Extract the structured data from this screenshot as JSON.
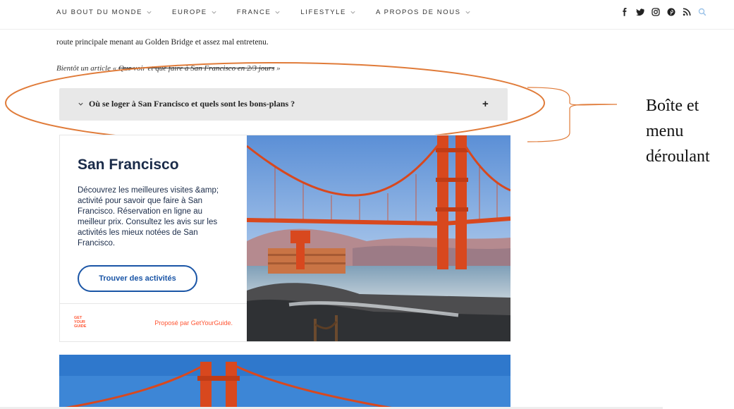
{
  "nav": {
    "items": [
      {
        "label": "AU BOUT DU MONDE"
      },
      {
        "label": "EUROPE"
      },
      {
        "label": "FRANCE"
      },
      {
        "label": "LIFESTYLE"
      },
      {
        "label": "A PROPOS DE NOUS"
      }
    ],
    "social_icons": [
      "facebook-icon",
      "twitter-icon",
      "instagram-icon",
      "pinterest-icon",
      "rss-icon",
      "search-icon"
    ],
    "search_color": "#9cc3e8"
  },
  "article": {
    "paragraph": "route principale menant au Golden Bridge et assez mal entretenu.",
    "teaser_prefix": "Bientôt un article « ",
    "teaser_link": "Que voir et que faire à San Francisco en 2/3 jours",
    "teaser_suffix": " »"
  },
  "accordion": {
    "title": "Où se loger à San Francisco et quels sont les bons-plans ?",
    "toggle": "+"
  },
  "annotation": {
    "label": "Boîte et menu déroulant",
    "color": "#e07b39"
  },
  "widget": {
    "title": "San Francisco",
    "description": "Découvrez les meilleures visites &amp; activité pour savoir que faire à San Francisco. Réservation en ligne au meilleur prix. Consultez les avis sur les activités les mieux notées de San Francisco.",
    "button_label": "Trouver des activités",
    "logo_text": "GET YOUR GUIDE",
    "powered_by": "Proposé par GetYourGuide.",
    "brand_color": "#ff5533",
    "button_color": "#1a55a6"
  }
}
